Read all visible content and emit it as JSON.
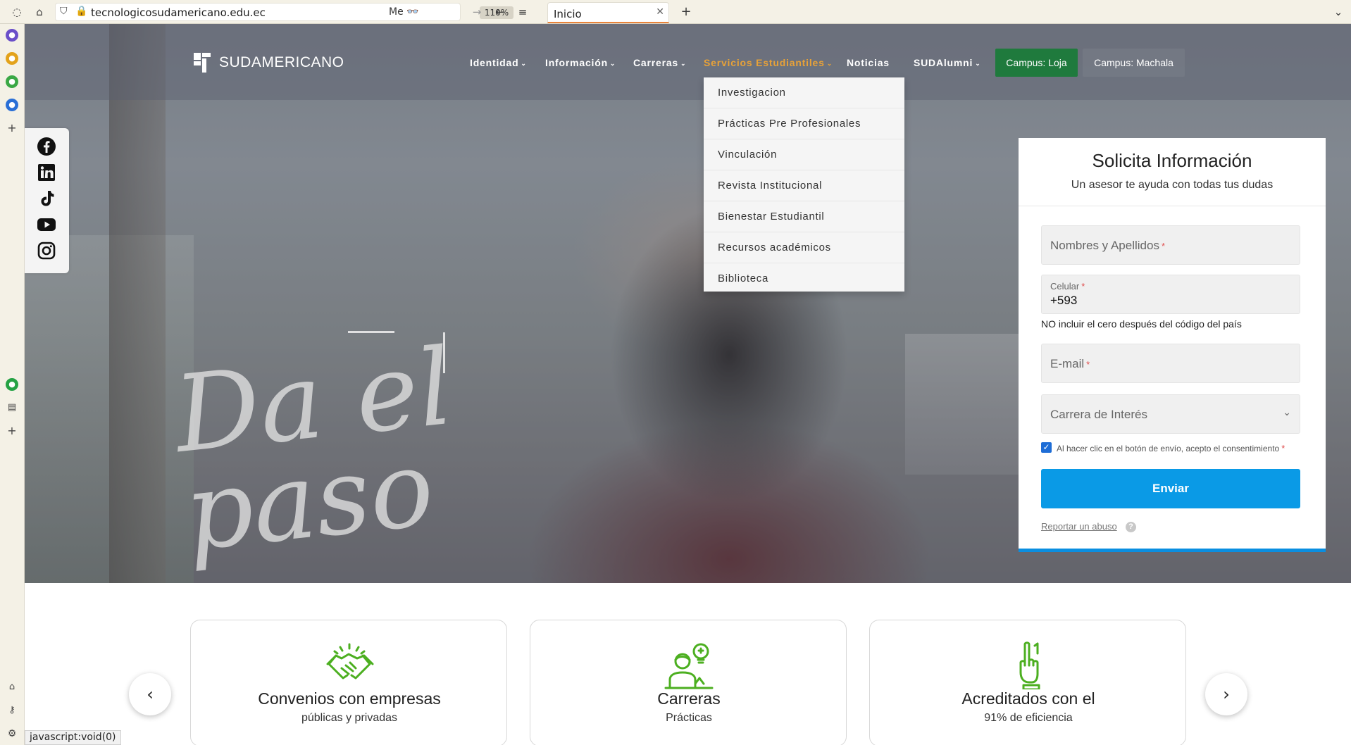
{
  "browser": {
    "url": "tecnologicosudamericano.edu.ec",
    "reader": "Me",
    "zoom": "110%",
    "tab_title": "Inicio"
  },
  "site": {
    "logo_text": "SUDAMERICANO",
    "nav": [
      {
        "label": "Identidad"
      },
      {
        "label": "Información"
      },
      {
        "label": "Carreras"
      },
      {
        "label": "Servicios Estudiantiles"
      },
      {
        "label": "Noticias"
      },
      {
        "label": "SUDAlumni"
      }
    ],
    "campus_loja": "Campus: Loja",
    "campus_machala": "Campus: Machala",
    "dropdown": [
      "Investigacion",
      "Prácticas Pre Profesionales",
      "Vinculación",
      "Revista Institucional",
      "Bienestar Estudiantil",
      "Recursos académicos",
      "Biblioteca"
    ],
    "hero_script": "Da el paso",
    "accent_orange": "#e8a238",
    "accent_green": "#1f7a3d",
    "accent_blue": "#0a9ae6"
  },
  "social": [
    "facebook-icon",
    "linkedin-icon",
    "tiktok-icon",
    "youtube-icon",
    "instagram-icon"
  ],
  "form": {
    "title": "Solicita Información",
    "subtitle": "Un asesor te ayuda con todas tus dudas",
    "name_placeholder": "Nombres y Apellidos",
    "phone_label": "Celular",
    "phone_value": "+593",
    "phone_hint": "NO incluir el cero después del código del país",
    "email_placeholder": "E-mail",
    "career_placeholder": "Carrera de Interés",
    "required_mark": "*",
    "consent": "Al hacer clic en el botón de envío, acepto el consentimiento",
    "submit": "Enviar",
    "abuse": "Reportar un abuso",
    "help": "?"
  },
  "features": [
    {
      "title": "Convenios con empresas",
      "subtitle": "públicas y privadas",
      "icon": "handshake-icon"
    },
    {
      "title": "Carreras",
      "subtitle": "Prácticas",
      "icon": "student-idea-icon"
    },
    {
      "title": "Acreditados con el",
      "subtitle": "91% de eficiencia",
      "icon": "number-one-hand-icon"
    }
  ],
  "status_bar": "javascript:void(0)"
}
